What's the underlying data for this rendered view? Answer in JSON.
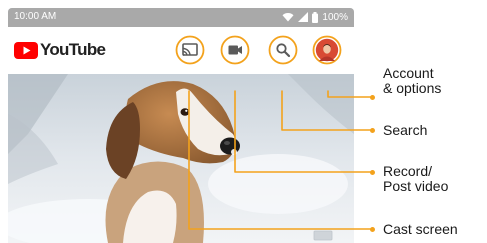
{
  "status_bar": {
    "time": "10:00 AM",
    "battery": "100%"
  },
  "app": {
    "brand": "YouTube"
  },
  "toolbar": {
    "cast_icon": "cast-icon",
    "record_icon": "video-camera-icon",
    "search_icon": "search-icon",
    "account_icon": "account-avatar"
  },
  "callouts": {
    "account": [
      "Account",
      "& options"
    ],
    "search": "Search",
    "record": [
      "Record/",
      "Post video"
    ],
    "cast": "Cast screen"
  },
  "colors": {
    "accent": "#f3a21c",
    "brand_red": "#ff0000",
    "status_bar": "#a9a9a9"
  }
}
